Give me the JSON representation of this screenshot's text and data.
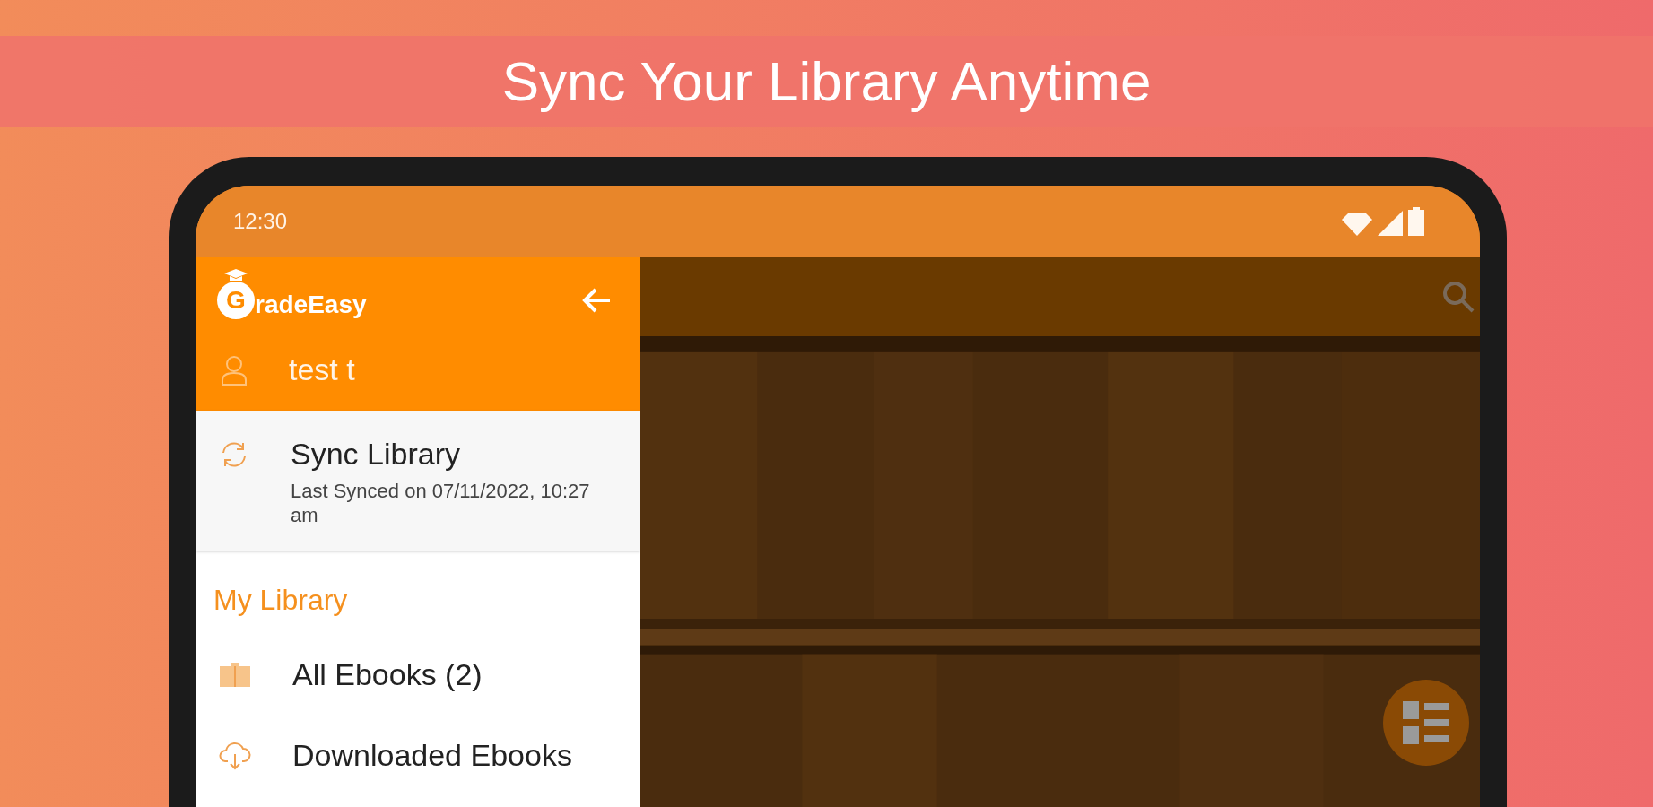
{
  "banner": {
    "title": "Sync Your Library Anytime"
  },
  "status_bar": {
    "time": "12:30"
  },
  "drawer": {
    "logo": {
      "letter": "G",
      "text": "radeEasy"
    },
    "user": "test t",
    "sync": {
      "title": "Sync Library",
      "subtitle": "Last Synced on 07/11/2022, 10:27 am"
    },
    "section": "My Library",
    "items": [
      {
        "kind": "book",
        "label": "All Ebooks (2)"
      },
      {
        "kind": "download",
        "label": "Downloaded Ebooks"
      }
    ]
  }
}
